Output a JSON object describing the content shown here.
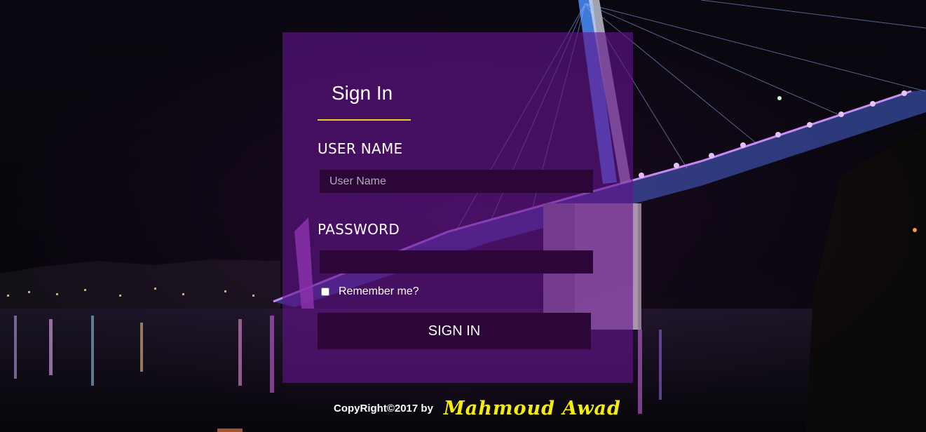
{
  "login": {
    "title": "Sign In",
    "username_label": "USER NAME",
    "username_placeholder": "User Name",
    "username_value": "",
    "password_label": "PASSWORD",
    "password_value": "",
    "remember_label": "Remember me?",
    "remember_checked": false,
    "submit_label": "SIGN IN"
  },
  "footer": {
    "copyright": "CopyRight©2017 by",
    "author": "Mahmoud Awad"
  },
  "colors": {
    "panel": "#64148c",
    "input_bg": "#2b0636",
    "accent_underline": "#f3c623",
    "author_text": "#f6f000"
  },
  "background": {
    "description_icon": "night-bridge-photo"
  }
}
